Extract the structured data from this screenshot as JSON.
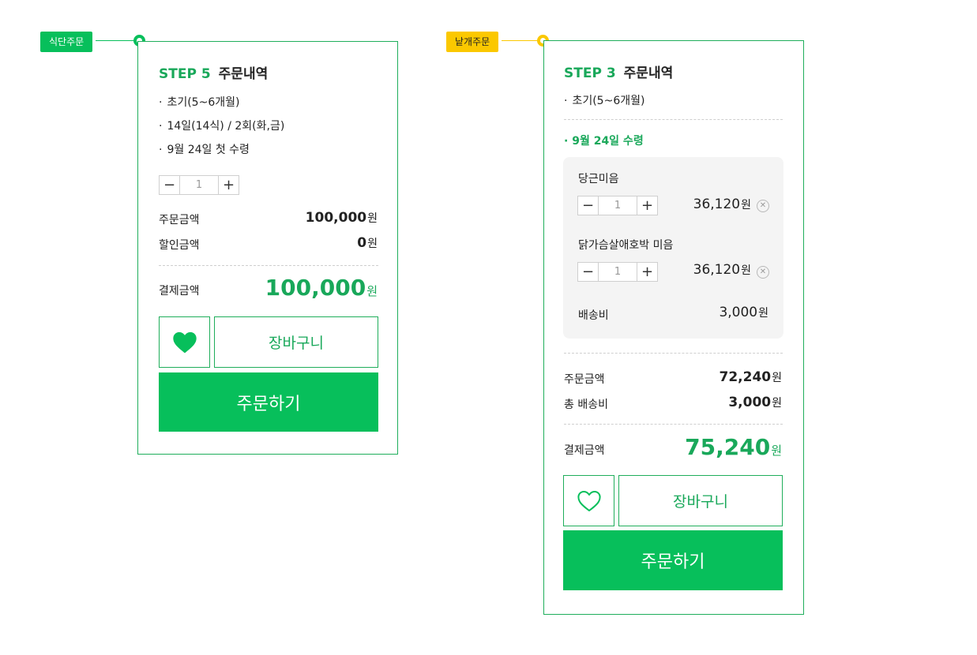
{
  "colors": {
    "accent": "#07bf5b",
    "accent_text": "#19a85a",
    "yellow": "#fbc800"
  },
  "left": {
    "tag": "식단주문",
    "step": "STEP 5",
    "title": "주문내역",
    "items": [
      "초기(5~6개월)",
      "14일(14식) / 2회(화,금)",
      "9월 24일 첫 수령"
    ],
    "qty": "1",
    "order_amount_label": "주문금액",
    "order_amount": "100,000",
    "discount_label": "할인금액",
    "discount": "0",
    "pay_label": "결제금액",
    "pay_amount": "100,000",
    "currency": "원",
    "wish_icon": "heart-filled-icon",
    "cart_label": "장바구니",
    "order_label": "주문하기"
  },
  "right": {
    "tag": "낱개주문",
    "step": "STEP 3",
    "title": "주문내역",
    "item": "초기(5~6개월)",
    "delivery": "9월 24일 수령",
    "products": [
      {
        "name": "당근미음",
        "qty": "1",
        "price": "36,120"
      },
      {
        "name": "닭가슴살애호박 미음",
        "qty": "1",
        "price": "36,120"
      }
    ],
    "shipping_label": "배송비",
    "shipping": "3,000",
    "order_amount_label": "주문금액",
    "order_amount": "72,240",
    "total_shipping_label": "총 배송비",
    "total_shipping": "3,000",
    "pay_label": "결제금액",
    "pay_amount": "75,240",
    "currency": "원",
    "wish_icon": "heart-outline-icon",
    "cart_label": "장바구니",
    "order_label": "주문하기"
  }
}
